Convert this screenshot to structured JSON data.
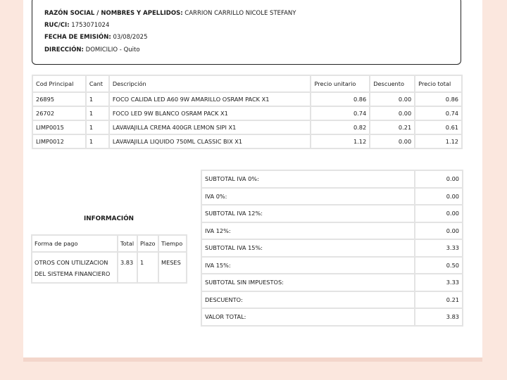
{
  "header": {
    "razon_label": "RAZÓN SOCIAL / NOMBRES Y APELLIDOS:",
    "razon_value": "CARRION CARRILLO NICOLE STEFANY",
    "ruc_label": "RUC/CI:",
    "ruc_value": "1753071024",
    "fecha_label": "FECHA DE EMISIÓN:",
    "fecha_value": "03/08/2025",
    "direccion_label": "DIRECCIÓN:",
    "direccion_value": "DOMICILIO - Quito"
  },
  "items": {
    "columns": [
      "Cod Principal",
      "Cant",
      "Descripción",
      "Precio unitario",
      "Descuento",
      "Precio total"
    ],
    "rows": [
      [
        "26895",
        "1",
        "FOCO CALIDA LED A60 9W AMARILLO OSRAM PACK X1",
        "0.86",
        "0.00",
        "0.86"
      ],
      [
        "26702",
        "1",
        "FOCO LED 9W BLANCO OSRAM PACK X1",
        "0.74",
        "0.00",
        "0.74"
      ],
      [
        "LIMP0015",
        "1",
        "LAVAVAJILLA CREMA 400GR LEMON SIPI X1",
        "0.82",
        "0.21",
        "0.61"
      ],
      [
        "LIMP0012",
        "1",
        "LAVAVAJILLA LIQUIDO 750ML CLASSIC BIX X1",
        "1.12",
        "0.00",
        "1.12"
      ]
    ]
  },
  "info": {
    "title": "INFORMACIÓN",
    "columns": [
      "Forma de pago",
      "Total",
      "Plazo",
      "Tiempo"
    ],
    "row": [
      "OTROS CON UTILIZACION DEL SISTEMA FINANCIERO",
      "3.83",
      "1",
      "MESES"
    ]
  },
  "totals": [
    {
      "label": "SUBTOTAL IVA 0%:",
      "value": "0.00"
    },
    {
      "label": "IVA 0%:",
      "value": "0.00"
    },
    {
      "label": "SUBTOTAL IVA 12%:",
      "value": "0.00"
    },
    {
      "label": "IVA 12%:",
      "value": "0.00"
    },
    {
      "label": "SUBTOTAL IVA 15%:",
      "value": "3.33"
    },
    {
      "label": "IVA 15%:",
      "value": "0.50"
    },
    {
      "label": "SUBTOTAL SIN IMPUESTOS:",
      "value": "3.33"
    },
    {
      "label": "DESCUENTO:",
      "value": "0.21"
    },
    {
      "label": "VALOR TOTAL:",
      "value": "3.83"
    }
  ]
}
